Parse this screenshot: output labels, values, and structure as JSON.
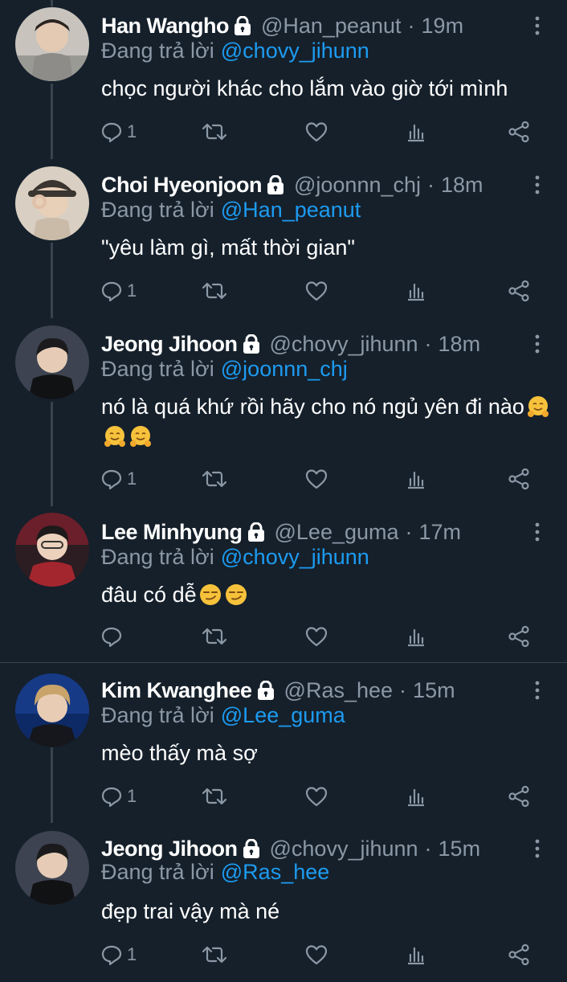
{
  "colors": {
    "background": "#15202b",
    "text": "#ffffff",
    "muted": "#8b98a5",
    "link": "#1d9bf0",
    "divider": "#38444d"
  },
  "tweets": [
    {
      "name": "Han Wangho",
      "handle": "@Han_peanut",
      "time": "19m",
      "reply_label": "Đang trả lời",
      "reply_to": "@chovy_jihunn",
      "text": "chọc người khác cho lắm vào giờ tới mình",
      "emojis": [],
      "reply_count": "1",
      "avatar_icon": "avatar-hoodie",
      "avatar_color": "#9a9a95"
    },
    {
      "name": "Choi Hyeonjoon",
      "handle": "@joonnn_chj",
      "time": "18m",
      "reply_label": "Đang trả lời",
      "reply_to": "@Han_peanut",
      "text": "\"yêu làm gì, mất thời gian\"",
      "emojis": [],
      "reply_count": "1",
      "avatar_icon": "avatar-cap",
      "avatar_color": "#c9bba8"
    },
    {
      "name": "Jeong Jihoon",
      "handle": "@chovy_jihunn",
      "time": "18m",
      "reply_label": "Đang trả lời",
      "reply_to": "@joonnn_chj",
      "text": "nó là quá khứ rồi hãy cho nó ngủ yên đi nào",
      "emojis": [
        "hugging-face-emoji",
        "hugging-face-emoji",
        "hugging-face-emoji"
      ],
      "reply_count": "1",
      "avatar_icon": "avatar-dark",
      "avatar_color": "#2a2e33"
    },
    {
      "name": "Lee Minhyung",
      "handle": "@Lee_guma",
      "time": "17m",
      "reply_label": "Đang trả lời",
      "reply_to": "@chovy_jihunn",
      "text": "đâu có dễ",
      "emojis": [
        "smirking-face-emoji",
        "smirking-face-emoji"
      ],
      "reply_count": "",
      "avatar_icon": "avatar-red",
      "avatar_color": "#a3262e"
    },
    {
      "name": "Kim Kwanghee",
      "handle": "@Ras_hee",
      "time": "15m",
      "reply_label": "Đang trả lời",
      "reply_to": "@Lee_guma",
      "text": "mèo thấy mà sợ",
      "emojis": [],
      "reply_count": "1",
      "avatar_icon": "avatar-blue",
      "avatar_color": "#1e3f8a"
    },
    {
      "name": "Jeong Jihoon",
      "handle": "@chovy_jihunn",
      "time": "15m",
      "reply_label": "Đang trả lời",
      "reply_to": "@Ras_hee",
      "text": "đẹp trai vậy mà né",
      "emojis": [],
      "reply_count": "1",
      "avatar_icon": "avatar-dark",
      "avatar_color": "#2a2e33"
    }
  ]
}
